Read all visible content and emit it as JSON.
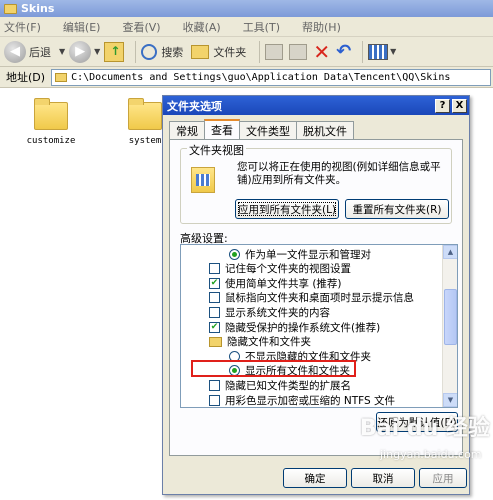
{
  "window": {
    "title": "Skins"
  },
  "menu": [
    "文件(F)",
    "编辑(E)",
    "查看(V)",
    "收藏(A)",
    "工具(T)",
    "帮助(H)"
  ],
  "toolbar": {
    "back": "后退",
    "search": "搜索",
    "folders": "文件夹"
  },
  "address": {
    "label": "地址(D)",
    "path": "C:\\Documents and Settings\\guo\\Application Data\\Tencent\\QQ\\Skins"
  },
  "files": [
    "customize",
    "system"
  ],
  "dialog": {
    "title": "文件夹选项",
    "help": "?",
    "close": "X",
    "tabs": [
      "常规",
      "查看",
      "文件类型",
      "脱机文件"
    ],
    "group_label": "文件夹视图",
    "group_desc": "您可以将正在使用的视图(例如详细信息或平铺)应用到所有文件夹。",
    "apply_all": "应用到所有文件夹(L)",
    "reset_all": "重置所有文件夹(R)",
    "advanced_label": "高级设置:",
    "settings": [
      {
        "kind": "radio",
        "checked": true,
        "label": "作为单一文件显示和管理对"
      },
      {
        "kind": "check",
        "checked": false,
        "label": "记住每个文件夹的视图设置"
      },
      {
        "kind": "check",
        "checked": true,
        "label": "使用简单文件共享 (推荐)"
      },
      {
        "kind": "check",
        "checked": false,
        "label": "鼠标指向文件夹和桌面项时显示提示信息"
      },
      {
        "kind": "check",
        "checked": false,
        "label": "显示系统文件夹的内容"
      },
      {
        "kind": "check",
        "checked": true,
        "label": "隐藏受保护的操作系统文件(推荐)"
      },
      {
        "kind": "folder",
        "checked": false,
        "label": "隐藏文件和文件夹"
      },
      {
        "kind": "radio",
        "checked": false,
        "label": "不显示隐藏的文件和文件夹"
      },
      {
        "kind": "radio",
        "checked": true,
        "label": "显示所有文件和文件夹"
      },
      {
        "kind": "check",
        "checked": false,
        "label": "隐藏已知文件类型的扩展名"
      },
      {
        "kind": "check",
        "checked": false,
        "label": "用彩色显示加密或压缩的 NTFS 文件"
      }
    ],
    "restore_defaults": "还原为默认值(D)",
    "ok": "确定",
    "cancel": "取消",
    "apply": "应用"
  },
  "watermark": {
    "text": "Bai du 经验",
    "sub": "jingyan.baidu.com"
  }
}
